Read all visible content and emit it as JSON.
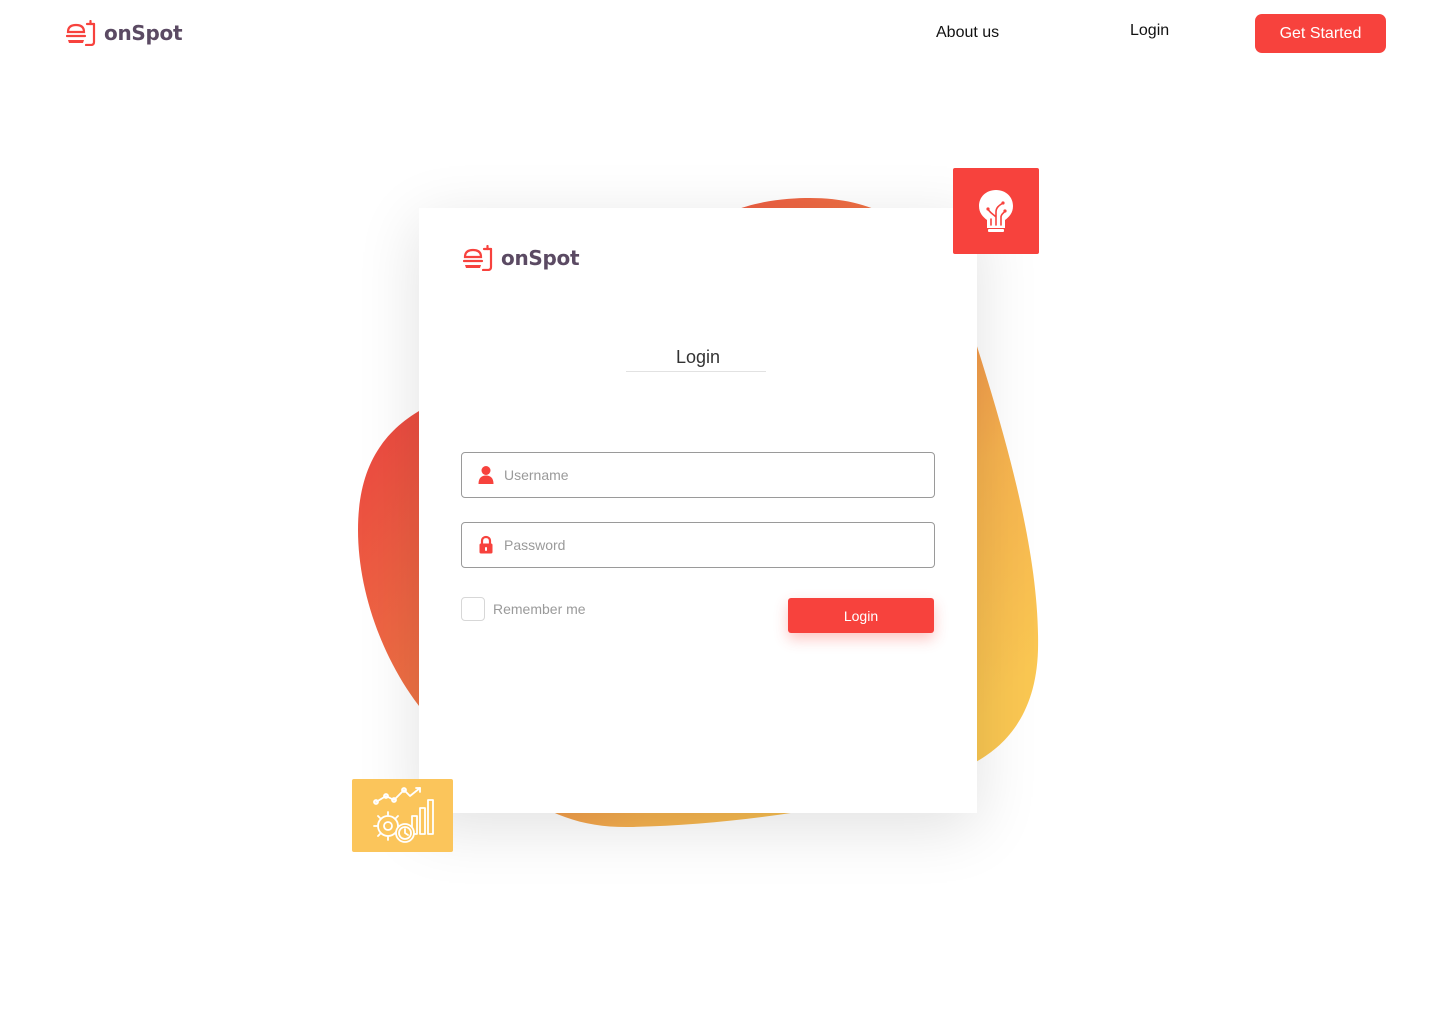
{
  "brand": {
    "name": "onSpot",
    "logo_icon": "burger-box-icon",
    "accent_color": "#f7423d",
    "secondary_color": "#fbc55b",
    "text_color": "#5b4a63"
  },
  "nav": {
    "about_label": "About us",
    "login_label": "Login",
    "get_started_label": "Get Started"
  },
  "tiles": {
    "top_right_icon": "lightbulb-icon",
    "bottom_left_icon": "analytics-gears-icon"
  },
  "login_form": {
    "title": "Login",
    "username": {
      "icon": "user-icon",
      "placeholder": "Username",
      "value": ""
    },
    "password": {
      "icon": "lock-icon",
      "placeholder": "Password",
      "value": ""
    },
    "remember_label": "Remember me",
    "remember_checked": false,
    "submit_label": "Login"
  }
}
